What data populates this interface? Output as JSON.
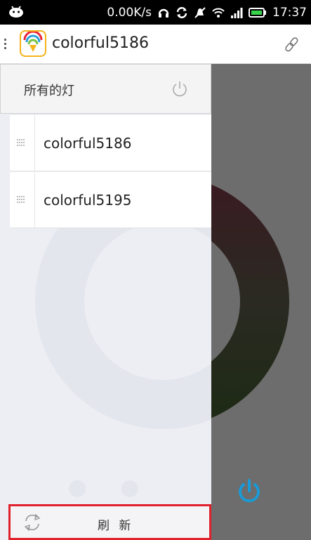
{
  "status_bar": {
    "net_speed": "0.00K/s",
    "time": "17:37",
    "icons": [
      "android-icon",
      "headset-icon",
      "sync-icon",
      "muted-notification-icon",
      "wifi-icon",
      "signal-icon",
      "battery-icon"
    ]
  },
  "app_bar": {
    "title": "colorful5186",
    "icons": [
      "menu-icon",
      "app-logo-icon",
      "link-icon"
    ]
  },
  "drawer": {
    "all_lights": {
      "label": "所有的灯",
      "icon": "power-icon"
    },
    "devices": [
      {
        "name": "colorful5186"
      },
      {
        "name": "colorful5195"
      }
    ],
    "footer": {
      "label": "刷 新",
      "icon": "refresh-icon"
    }
  },
  "main": {
    "icon": "power-icon"
  },
  "colors": {
    "status_bar_bg": "#000000",
    "drawer_bg": "#eceef4",
    "main_bg": "#6d6d6d",
    "power_accent": "#1a9ad6",
    "highlight_border": "#e0202a",
    "logo_border": "#f4b31a"
  }
}
